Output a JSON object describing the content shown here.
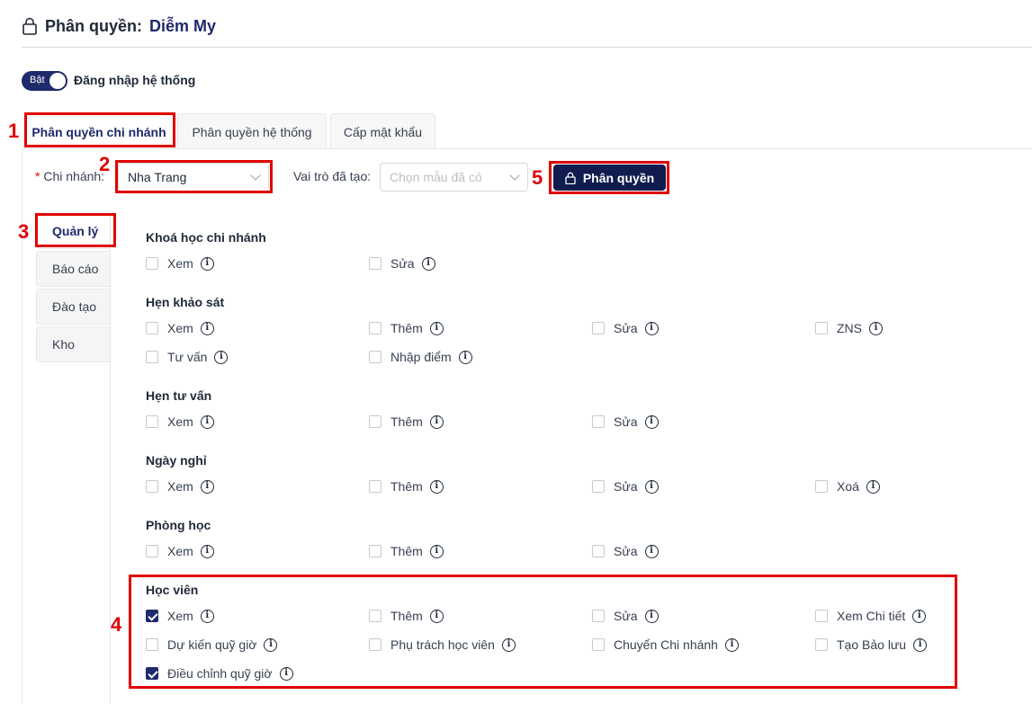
{
  "header": {
    "label": "Phân quyền:",
    "user": "Diễm My"
  },
  "login_toggle": {
    "state_label": "Bật",
    "label": "Đăng nhập hệ thống"
  },
  "tabs": [
    {
      "label": "Phân quyền chi nhánh"
    },
    {
      "label": "Phân quyền hệ thống"
    },
    {
      "label": "Cấp mật khẩu"
    }
  ],
  "filters": {
    "branch_label": "Chi nhánh:",
    "branch_value": "Nha Trang",
    "role_label": "Vai trò đã tạo:",
    "role_placeholder": "Chọn mẫu đã có",
    "submit_label": "Phân quyền"
  },
  "side_tabs": [
    {
      "label": "Quản lý"
    },
    {
      "label": "Báo cáo"
    },
    {
      "label": "Đào tạo"
    },
    {
      "label": "Kho"
    }
  ],
  "markers": [
    "1",
    "2",
    "3",
    "4",
    "5"
  ],
  "sections": [
    {
      "title": "Khoá học chi nhánh",
      "perms": [
        {
          "label": "Xem",
          "checked": false
        },
        {
          "label": "Sửa",
          "checked": false
        }
      ]
    },
    {
      "title": "Hẹn khảo sát",
      "perms": [
        {
          "label": "Xem",
          "checked": false
        },
        {
          "label": "Thêm",
          "checked": false
        },
        {
          "label": "Sửa",
          "checked": false
        },
        {
          "label": "ZNS",
          "checked": false
        },
        {
          "label": "Tư vấn",
          "checked": false
        },
        {
          "label": "Nhập điểm",
          "checked": false
        }
      ]
    },
    {
      "title": "Hẹn tư vấn",
      "perms": [
        {
          "label": "Xem",
          "checked": false
        },
        {
          "label": "Thêm",
          "checked": false
        },
        {
          "label": "Sửa",
          "checked": false
        }
      ]
    },
    {
      "title": "Ngày nghỉ",
      "perms": [
        {
          "label": "Xem",
          "checked": false
        },
        {
          "label": "Thêm",
          "checked": false
        },
        {
          "label": "Sửa",
          "checked": false
        },
        {
          "label": "Xoá",
          "checked": false
        }
      ]
    },
    {
      "title": "Phòng học",
      "perms": [
        {
          "label": "Xem",
          "checked": false
        },
        {
          "label": "Thêm",
          "checked": false
        },
        {
          "label": "Sửa",
          "checked": false
        }
      ]
    },
    {
      "title": "Học viên",
      "perms": [
        {
          "label": "Xem",
          "checked": true
        },
        {
          "label": "Thêm",
          "checked": false
        },
        {
          "label": "Sửa",
          "checked": false
        },
        {
          "label": "Xem Chi tiết",
          "checked": false
        },
        {
          "label": "Dự kiến quỹ giờ",
          "checked": false
        },
        {
          "label": "Phụ trách học viên",
          "checked": false
        },
        {
          "label": "Chuyển Chi nhánh",
          "checked": false
        },
        {
          "label": "Tạo Bảo lưu",
          "checked": false
        },
        {
          "label": "Điều chỉnh quỹ giờ",
          "checked": true
        }
      ]
    }
  ]
}
